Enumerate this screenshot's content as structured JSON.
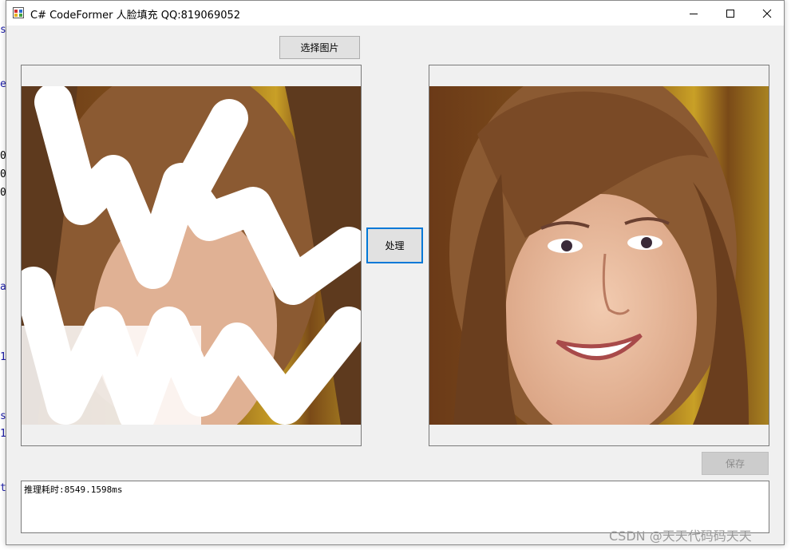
{
  "window": {
    "title": "C# CodeFormer 人脸填充 QQ:819069052"
  },
  "buttons": {
    "select_image": "选择图片",
    "process": "处理",
    "save": "保存"
  },
  "log": {
    "text": "推理耗时:8549.1598ms"
  },
  "watermark": "CSDN @天天代码码天天",
  "icons": [
    "app-icon",
    "minimize-icon",
    "maximize-icon",
    "close-icon"
  ],
  "colors": {
    "focus_border": "#0078d7",
    "window_bg": "#f0f0f0"
  }
}
